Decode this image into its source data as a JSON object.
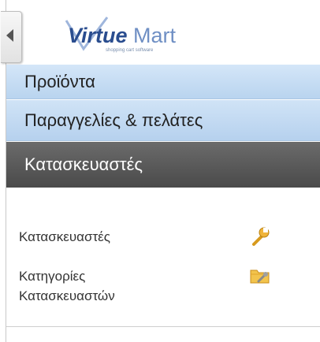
{
  "logo": {
    "brand_part1": "Virtue",
    "brand_part2": "Mart",
    "tagline": "shopping cart software"
  },
  "nav": [
    {
      "label": "Προϊόντα"
    },
    {
      "label": "Παραγγελίες & πελάτες"
    },
    {
      "label": "Κατασκευαστές"
    }
  ],
  "submenu": [
    {
      "label_lines": [
        "Κατασκευαστές"
      ],
      "icon": "wrench-icon"
    },
    {
      "label_lines": [
        "Κατηγορίες",
        "Κατασκευαστών"
      ],
      "icon": "folder-wrench-icon"
    }
  ],
  "colors": {
    "nav_blue": "#c6dcf3",
    "nav_active": "#555555",
    "brand_dark": "#2a4d8f",
    "brand_light": "#6f8fc4"
  }
}
